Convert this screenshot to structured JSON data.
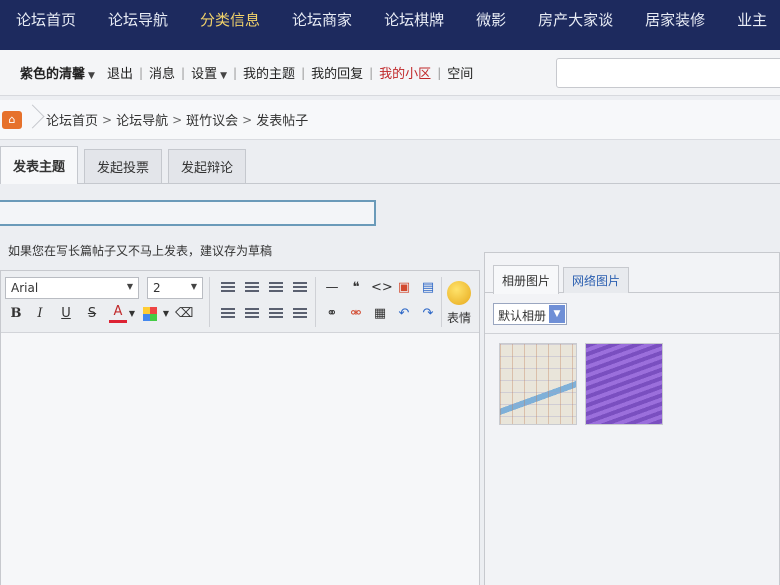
{
  "topnav": {
    "items": [
      "论坛首页",
      "论坛导航",
      "分类信息",
      "论坛商家",
      "论坛棋牌",
      "微影",
      "房产大家谈",
      "居家装修",
      "业主"
    ],
    "active_index": 2
  },
  "userbar": {
    "username": "紫色的清馨",
    "items": [
      "退出",
      "消息",
      "设置",
      "我的主题",
      "我的回复",
      "我的小区",
      "空间"
    ]
  },
  "breadcrumb": [
    "论坛首页",
    "论坛导航",
    "斑竹议会",
    "发表帖子"
  ],
  "tabs": [
    "发表主题",
    "发起投票",
    "发起辩论"
  ],
  "draft_tip": "如果您在写长篇帖子又不马上发表，建议存为草稿",
  "editor": {
    "font_family": "Arial",
    "font_size": "2",
    "format_buttons": [
      "B",
      "I",
      "U",
      "S",
      "A"
    ],
    "emoji_label": "表情"
  },
  "image_panel": {
    "tabs": [
      "相册图片",
      "网络图片"
    ],
    "album_select": "默认相册"
  },
  "colors": {
    "nav_bg": "#1d2a5e",
    "nav_active": "#f1d26a",
    "highlight_red": "#c0282a"
  }
}
